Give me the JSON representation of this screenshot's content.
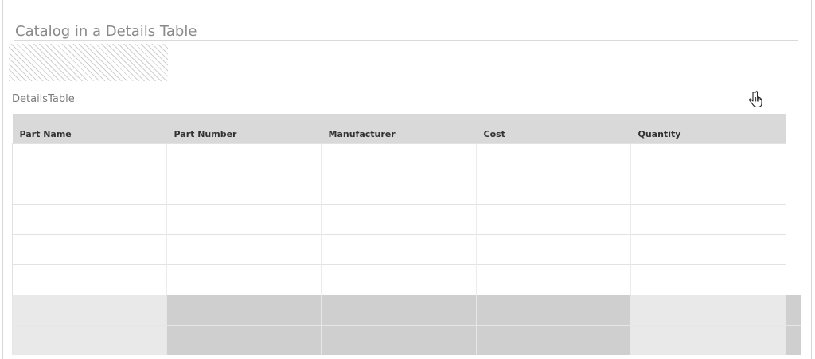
{
  "page": {
    "title": "Catalog in a Details Table"
  },
  "widget": {
    "label": "DetailsTable"
  },
  "table": {
    "columns": [
      "Part Name",
      "Part Number",
      "Manufacturer",
      "Cost",
      "Quantity"
    ],
    "empty_rows": 5,
    "shaded_rows": 2
  },
  "icons": {
    "cursor": "hand-pointer-icon"
  },
  "colors": {
    "header_bg": "#d9d9d9",
    "shaded_cell": "#cfcfcf",
    "shaded_light": "#e9e9e9",
    "title_text": "#8a8a8a"
  }
}
